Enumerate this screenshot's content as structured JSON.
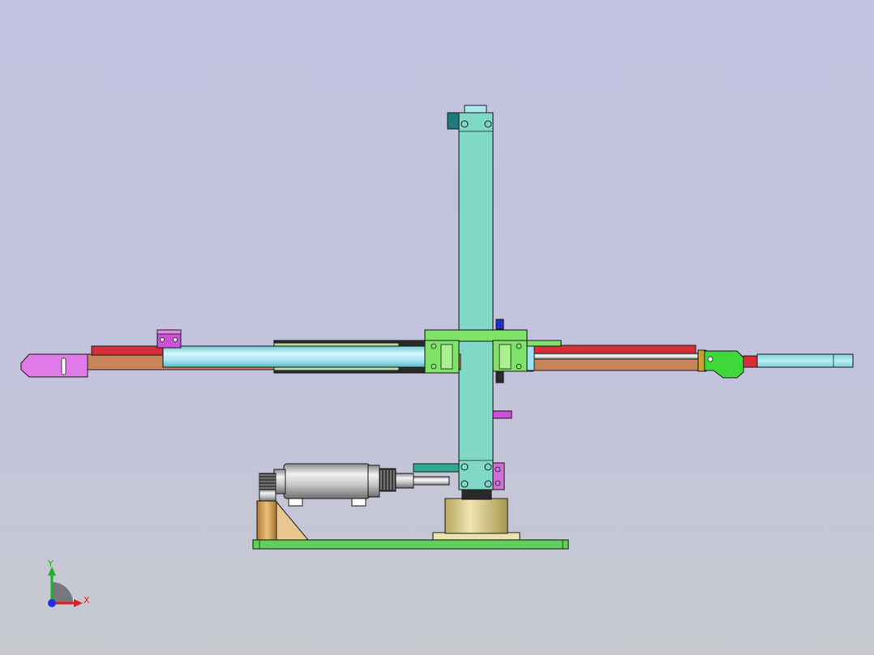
{
  "triad": {
    "x_label": "X",
    "y_label": "Y",
    "colors": {
      "x": "#e0201a",
      "y": "#1ab02a",
      "z": "#2030e0"
    }
  },
  "colors": {
    "background_top": "#c3c2e0",
    "background_bottom": "#c7c9cf",
    "mast": "#7fd9c6",
    "base_plate": "#5fd05a",
    "cylinder": "#9fe3f0",
    "rail_red": "#d8303a",
    "rail_brown": "#c8855a",
    "gripper_pink": "#e07ae8",
    "gripper_green": "#3fd83a",
    "slider_green": "#7fe36a",
    "motor": "#c9c9c9",
    "turntable": "#d8cc8a",
    "bracket_wood": "#d9a35a"
  }
}
